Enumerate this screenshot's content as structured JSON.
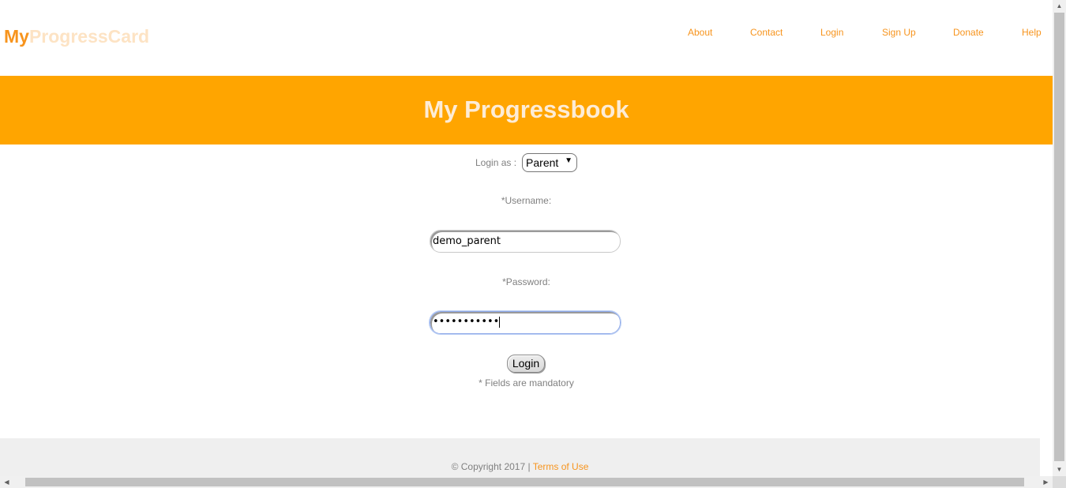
{
  "logo": {
    "my": "My",
    "rest": "ProgressCard"
  },
  "nav": {
    "about": "About",
    "contact": "Contact",
    "login": "Login",
    "signup": "Sign Up",
    "donate": "Donate",
    "help": "Help"
  },
  "banner": {
    "title": "My Progressbook"
  },
  "form": {
    "login_as_label": "Login as :",
    "login_as_value": "Parent",
    "username_label": "*Username:",
    "username_value": "demo_parent",
    "password_label": "*Password:",
    "password_masked": "•••••••••••",
    "login_button": "Login",
    "mandatory_note": "* Fields are mandatory"
  },
  "footer": {
    "copyright": "© Copyright 2017 | ",
    "terms": "Terms of Use"
  },
  "colors": {
    "accent": "#f7941d",
    "banner": "#ffa500",
    "footer_bg": "#efefef"
  },
  "icons": {
    "select_arrow": "chevron-down-icon"
  }
}
